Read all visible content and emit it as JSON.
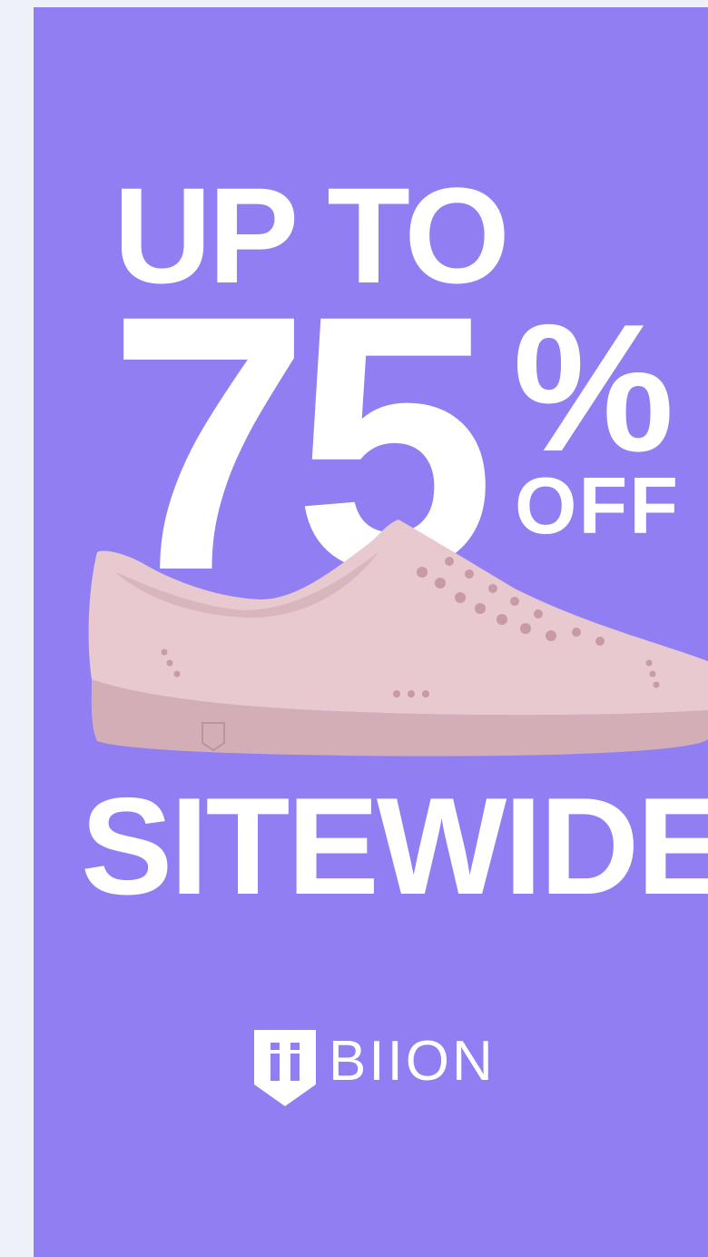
{
  "promo": {
    "line1": "UP TO",
    "amount": "75",
    "percent_sign": "%",
    "off": "OFF",
    "line3": "SITEWIDE"
  },
  "brand": {
    "name": "BIION",
    "logo_icon": "biion-shield-icon"
  },
  "product": {
    "image": "pink-sneaker-image"
  },
  "colors": {
    "background": "#917ef2",
    "page": "#eef1f8",
    "text": "#ffffff",
    "shoe": "#e7c9cf",
    "shoe_sole": "#d4aeb6"
  }
}
